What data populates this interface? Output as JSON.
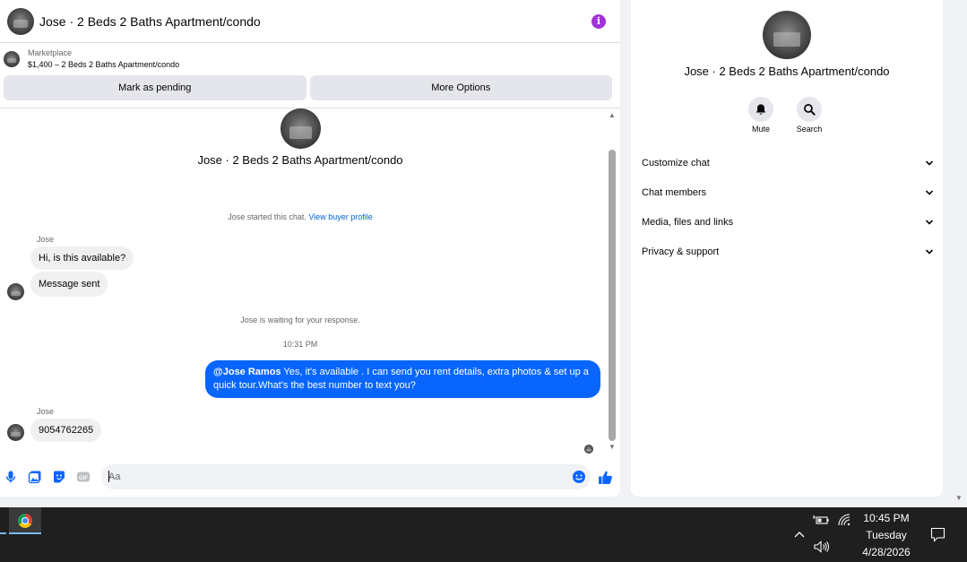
{
  "header": {
    "title": "Jose · 2 Beds 2 Baths Apartment/condo"
  },
  "listing": {
    "label": "Marketplace",
    "description": "$1,400 – 2 Beds 2 Baths Apartment/condo"
  },
  "actions": {
    "pending_label": "Mark as pending",
    "more_label": "More Options"
  },
  "conversation": {
    "title": "Jose · 2 Beds 2 Baths Apartment/condo",
    "started_text": "Jose started this chat.",
    "view_profile_link": "View buyer profile",
    "messages": [
      {
        "sender": "Jose",
        "text": "Hi, is this available?"
      },
      {
        "text": "Message sent"
      }
    ],
    "waiting_text": "Jose is waiting for your response.",
    "timestamp": "10:31 PM",
    "outgoing": {
      "mention": "@Jose Ramos",
      "text": " Yes, it's available .  I can send you rent details, extra photos & set up a quick tour.What's the best number to text you?"
    },
    "reply": {
      "sender": "Jose",
      "text": "9054762265"
    }
  },
  "composer": {
    "placeholder": "Aa"
  },
  "side_panel": {
    "title": "Jose · 2 Beds 2 Baths Apartment/condo",
    "mute_label": "Mute",
    "search_label": "Search",
    "menu": [
      "Customize chat",
      "Chat members",
      "Media, files and links",
      "Privacy & support"
    ]
  },
  "taskbar": {
    "time": "10:45 PM",
    "day": "Tuesday",
    "date": "4/28/2026"
  },
  "colors": {
    "accent": "#0866ff",
    "info": "#a033d9",
    "taskbar": "#1f1f1f"
  },
  "icons": [
    "info-icon",
    "mic-icon",
    "photo-icon",
    "sticker-icon",
    "gif-icon",
    "emoji-icon",
    "like-icon",
    "bell-icon",
    "search-icon",
    "chevron-down-icon",
    "chrome-icon",
    "battery-icon",
    "wifi-icon",
    "volume-icon",
    "notification-icon"
  ]
}
